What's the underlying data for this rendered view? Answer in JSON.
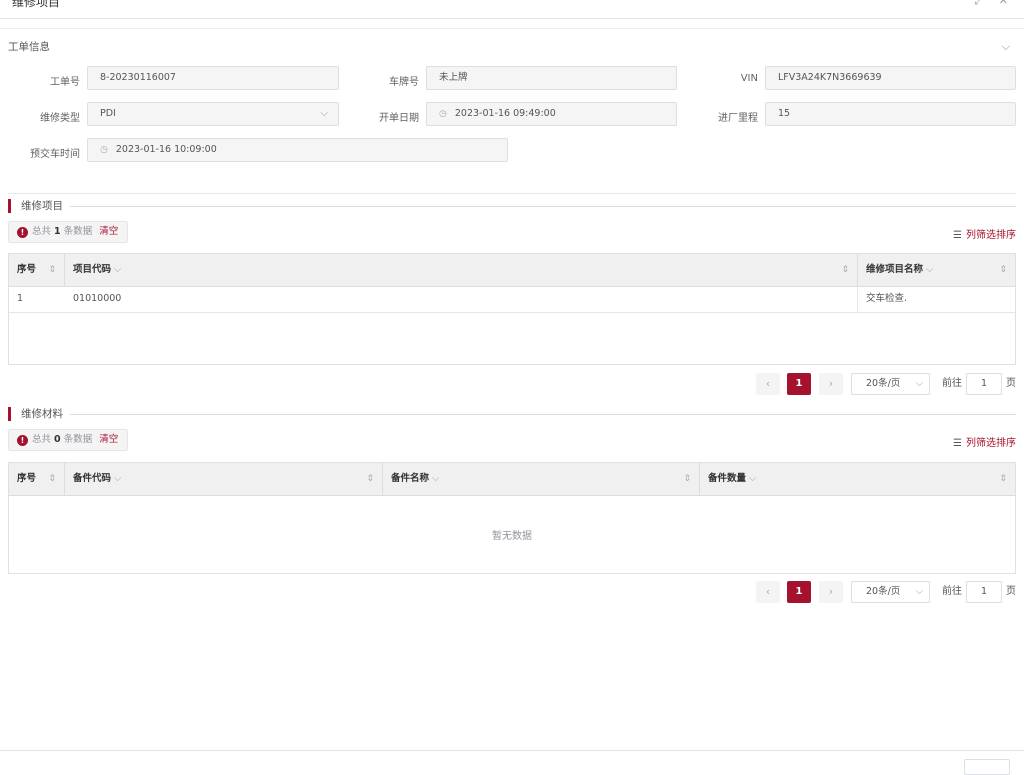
{
  "window": {
    "title": "维修项目",
    "controls": "⤢ ✕"
  },
  "header": {
    "title": "工单信息",
    "collapse_icon": "chevron-down-icon"
  },
  "form": {
    "order_no": {
      "label": "工单号",
      "value": "8-20230116007"
    },
    "plate_no": {
      "label": "车牌号",
      "value": "未上牌"
    },
    "vin": {
      "label": "VIN",
      "value": "LFV3A24K7N3669639"
    },
    "repair_type": {
      "label": "维修类型",
      "value": "PDI"
    },
    "open_date": {
      "label": "开单日期",
      "value": "2023-01-16 09:49:00"
    },
    "mileage": {
      "label": "进厂里程",
      "value": "15"
    },
    "delivery_time": {
      "label": "预交车时间",
      "value": "2023-01-16 10:09:00"
    }
  },
  "items_section": {
    "title": "维修项目",
    "summary": {
      "prefix": "总共",
      "count": "1",
      "suffix": "条数据",
      "clear": "清空"
    },
    "filter_label": "列筛选排序",
    "columns": [
      "序号",
      "项目代码",
      "维修项目名称"
    ],
    "rows": [
      [
        "1",
        "01010000",
        "交车检查."
      ]
    ],
    "pager": {
      "current": "1",
      "page_size": "20条/页",
      "goto_prefix": "前往",
      "goto_value": "1",
      "goto_suffix": "页"
    }
  },
  "materials_section": {
    "title": "维修材料",
    "summary": {
      "prefix": "总共",
      "count": "0",
      "suffix": "条数据",
      "clear": "清空"
    },
    "filter_label": "列筛选排序",
    "columns": [
      "序号",
      "备件代码",
      "备件名称",
      "备件数量"
    ],
    "empty_text": "暂无数据",
    "pager": {
      "current": "1",
      "page_size": "20条/页",
      "goto_prefix": "前往",
      "goto_value": "1",
      "goto_suffix": "页"
    }
  },
  "colors": {
    "accent": "#a5122e",
    "field_bg": "#f5f5f5",
    "header_bg": "#f0f0f0"
  }
}
